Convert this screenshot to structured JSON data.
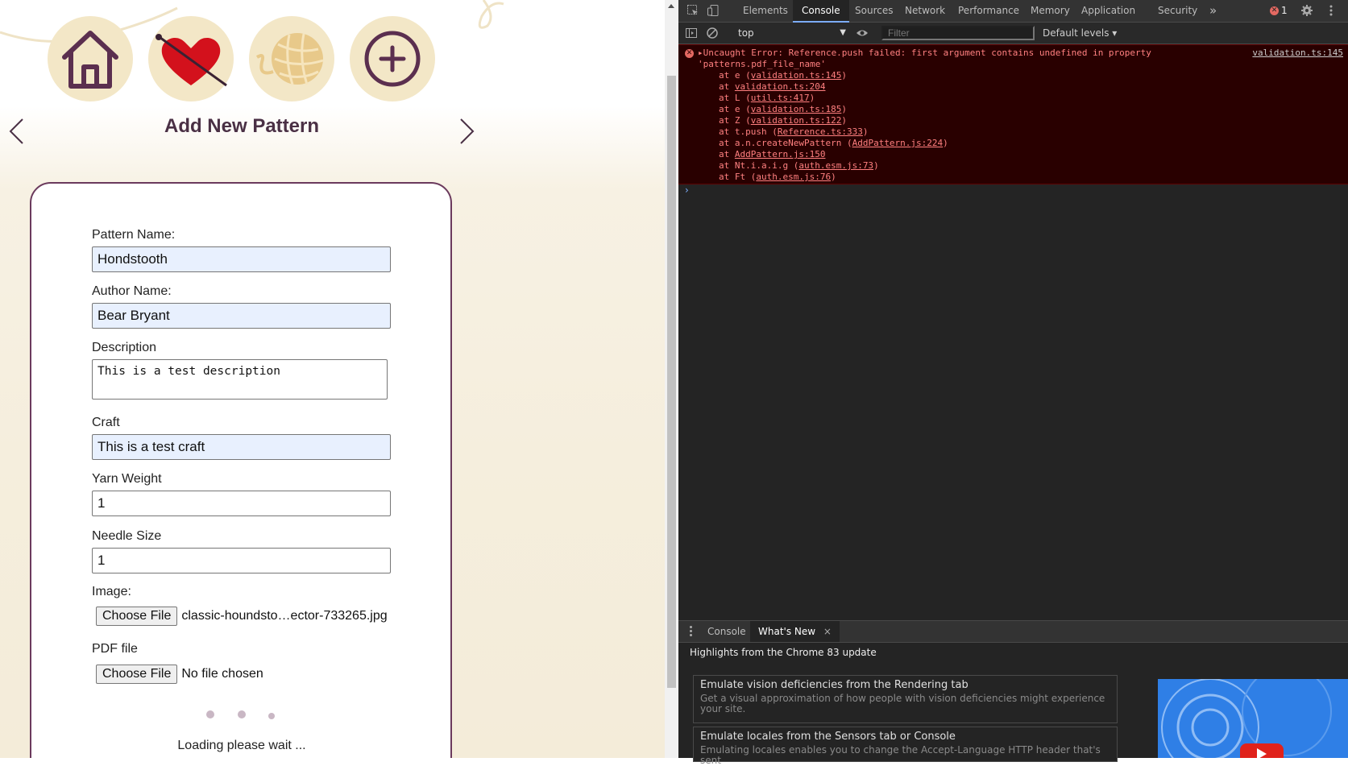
{
  "app": {
    "nav_icons": [
      "home-icon",
      "heart-needle-icon",
      "yarn-ball-icon",
      "add-circle-icon"
    ],
    "page_title": "Add New Pattern",
    "colors": {
      "primary": "#6b3a5d",
      "circle_bg": "#f3e7c7",
      "heart": "#d3111c"
    },
    "form": {
      "pattern_name_label": "Pattern Name:",
      "pattern_name_value": "Hondstooth",
      "author_label": "Author Name:",
      "author_value": "Bear Bryant",
      "description_label": "Description",
      "description_value": "This is a test description",
      "craft_label": "Craft",
      "craft_value": "This is a test craft",
      "yarn_label": "Yarn Weight",
      "yarn_value": "1",
      "needle_label": "Needle Size",
      "needle_value": "1",
      "image_label": "Image:",
      "image_button": "Choose File",
      "image_file": "classic-houndsto…ector-733265.jpg",
      "pdf_label": "PDF file",
      "pdf_button": "Choose File",
      "pdf_file": "No file chosen",
      "loading_text": "Loading please wait ..."
    }
  },
  "devtools": {
    "tabs": [
      "Elements",
      "Console",
      "Sources",
      "Network",
      "Performance",
      "Memory",
      "Application",
      "Security"
    ],
    "more_tabs": "»",
    "error_count": "1",
    "context": "top",
    "filter_placeholder": "Filter",
    "levels": "Default levels ▾",
    "error": {
      "line1": "▸Uncaught Error: Reference.push failed: first argument contains undefined in property",
      "line2": "'patterns.pdf_file_name'",
      "source": "validation.ts:145",
      "stack": [
        {
          "pre": "at e (",
          "link": "validation.ts:145",
          "post": ")"
        },
        {
          "pre": "at ",
          "link": "validation.ts:204",
          "post": ""
        },
        {
          "pre": "at L (",
          "link": "util.ts:417",
          "post": ")"
        },
        {
          "pre": "at e (",
          "link": "validation.ts:185",
          "post": ")"
        },
        {
          "pre": "at Z (",
          "link": "validation.ts:122",
          "post": ")"
        },
        {
          "pre": "at t.push (",
          "link": "Reference.ts:333",
          "post": ")"
        },
        {
          "pre": "at a.n.createNewPattern (",
          "link": "AddPattern.js:224",
          "post": ")"
        },
        {
          "pre": "at ",
          "link": "AddPattern.js:150",
          "post": ""
        },
        {
          "pre": "at Nt.i.a.i.g (",
          "link": "auth.esm.js:73",
          "post": ")"
        },
        {
          "pre": "at Ft (",
          "link": "auth.esm.js:76",
          "post": ")"
        }
      ]
    },
    "drawer": {
      "tab_console": "Console",
      "tab_whatsnew": "What's New",
      "close": "×",
      "header": "Highlights from the Chrome 83 update",
      "cards": [
        {
          "title": "Emulate vision deficiencies from the Rendering tab",
          "desc": "Get a visual approximation of how people with vision deficiencies might experience your site."
        },
        {
          "title": "Emulate locales from the Sensors tab or Console",
          "desc": "Emulating locales enables you to change the Accept-Language HTTP header that's sent"
        }
      ]
    }
  }
}
